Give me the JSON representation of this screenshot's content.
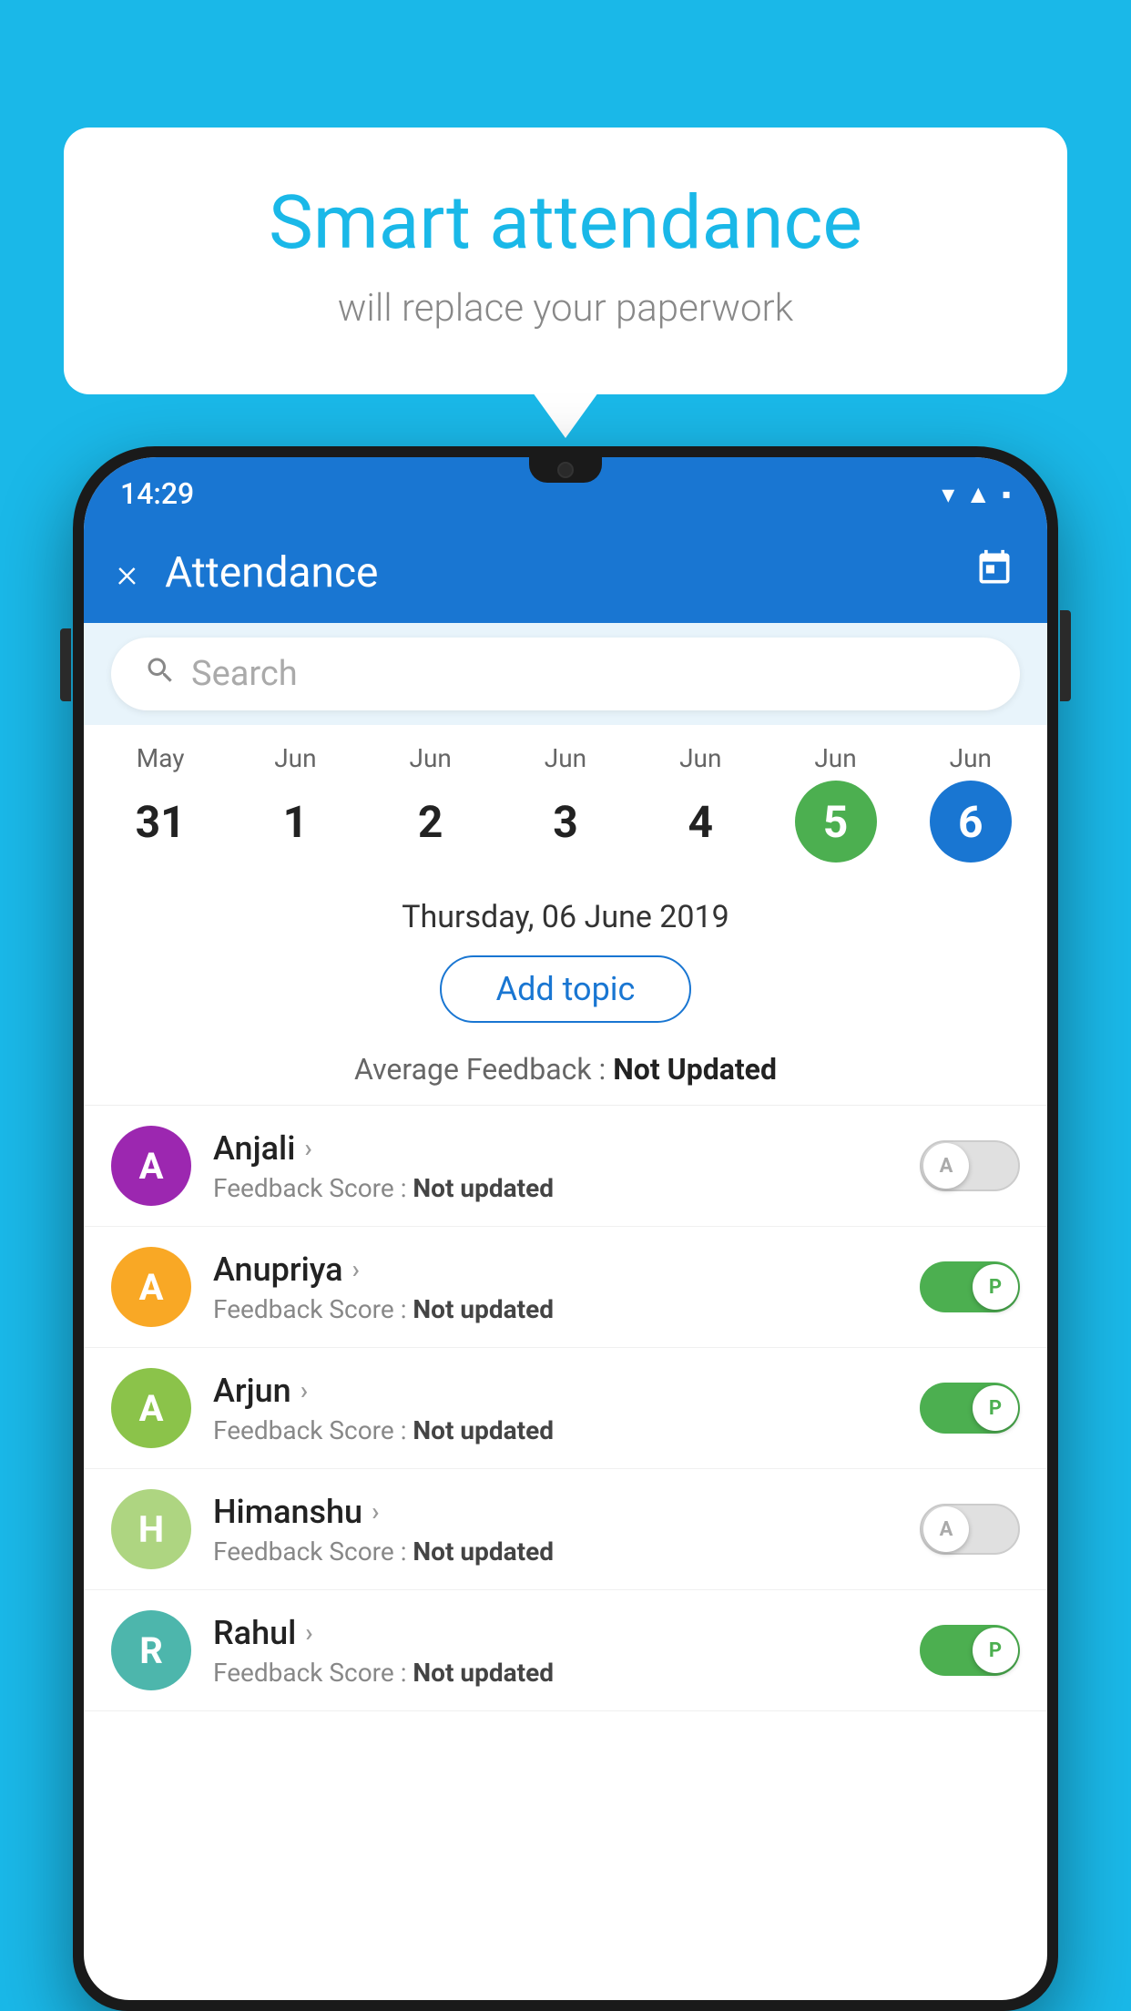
{
  "background_color": "#1ab8e8",
  "speech_bubble": {
    "title": "Smart attendance",
    "subtitle": "will replace your paperwork"
  },
  "phone": {
    "status_bar": {
      "time": "14:29",
      "icons": [
        "wifi",
        "signal",
        "battery"
      ]
    },
    "app_bar": {
      "title": "Attendance",
      "close_label": "×",
      "calendar_label": "📅"
    },
    "search": {
      "placeholder": "Search"
    },
    "calendar": {
      "days": [
        {
          "month": "May",
          "date": "31",
          "style": "normal"
        },
        {
          "month": "Jun",
          "date": "1",
          "style": "normal"
        },
        {
          "month": "Jun",
          "date": "2",
          "style": "normal"
        },
        {
          "month": "Jun",
          "date": "3",
          "style": "normal"
        },
        {
          "month": "Jun",
          "date": "4",
          "style": "normal"
        },
        {
          "month": "Jun",
          "date": "5",
          "style": "green"
        },
        {
          "month": "Jun",
          "date": "6",
          "style": "blue"
        }
      ]
    },
    "selected_date": "Thursday, 06 June 2019",
    "add_topic_label": "Add topic",
    "avg_feedback_label": "Average Feedback :",
    "avg_feedback_value": "Not Updated",
    "students": [
      {
        "name": "Anjali",
        "avatar_letter": "A",
        "avatar_color": "#9c27b0",
        "feedback_label": "Feedback Score :",
        "feedback_value": "Not updated",
        "toggle_state": "off",
        "toggle_letter": "A"
      },
      {
        "name": "Anupriya",
        "avatar_letter": "A",
        "avatar_color": "#f9a825",
        "feedback_label": "Feedback Score :",
        "feedback_value": "Not updated",
        "toggle_state": "on",
        "toggle_letter": "P"
      },
      {
        "name": "Arjun",
        "avatar_letter": "A",
        "avatar_color": "#8bc34a",
        "feedback_label": "Feedback Score :",
        "feedback_value": "Not updated",
        "toggle_state": "on",
        "toggle_letter": "P"
      },
      {
        "name": "Himanshu",
        "avatar_letter": "H",
        "avatar_color": "#aed581",
        "feedback_label": "Feedback Score :",
        "feedback_value": "Not updated",
        "toggle_state": "off",
        "toggle_letter": "A"
      },
      {
        "name": "Rahul",
        "avatar_letter": "R",
        "avatar_color": "#4db6ac",
        "feedback_label": "Feedback Score :",
        "feedback_value": "Not updated",
        "toggle_state": "on",
        "toggle_letter": "P"
      }
    ]
  }
}
